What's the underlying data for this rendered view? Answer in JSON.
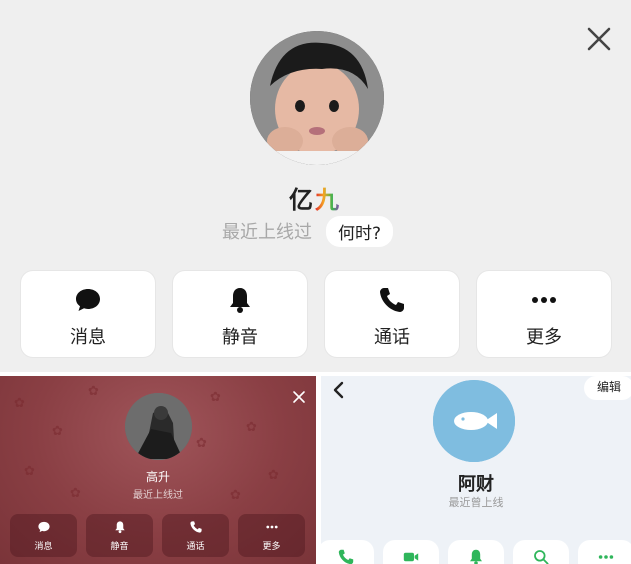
{
  "top_panel": {
    "profile": {
      "name": "亿",
      "name_deco": "九",
      "status": "最近上线过",
      "when_button": "何时?"
    },
    "actions": [
      {
        "label": "消息",
        "icon": "message-bubble-icon"
      },
      {
        "label": "静音",
        "icon": "bell-icon"
      },
      {
        "label": "通话",
        "icon": "phone-icon"
      },
      {
        "label": "更多",
        "icon": "more-dots-icon"
      }
    ]
  },
  "bottom_left_panel": {
    "profile": {
      "name": "高升",
      "status": "最近上线过"
    },
    "actions": [
      {
        "label": "消息",
        "icon": "message-bubble-icon"
      },
      {
        "label": "静音",
        "icon": "bell-icon"
      },
      {
        "label": "通话",
        "icon": "phone-icon"
      },
      {
        "label": "更多",
        "icon": "more-dots-icon"
      }
    ]
  },
  "bottom_right_panel": {
    "edit_button": "编辑",
    "profile": {
      "name": "阿财",
      "status": "最近曾上线"
    },
    "actions": [
      {
        "icon": "phone-icon"
      },
      {
        "icon": "video-camera-icon"
      },
      {
        "icon": "bell-icon"
      },
      {
        "icon": "search-icon"
      },
      {
        "icon": "more-dots-icon"
      }
    ]
  },
  "colors": {
    "top_bg": "#efefef",
    "bottom_left_bg": "#8a3f44",
    "bottom_right_bg": "#eef2f7",
    "bottom_right_accent": "#2fb65b"
  }
}
